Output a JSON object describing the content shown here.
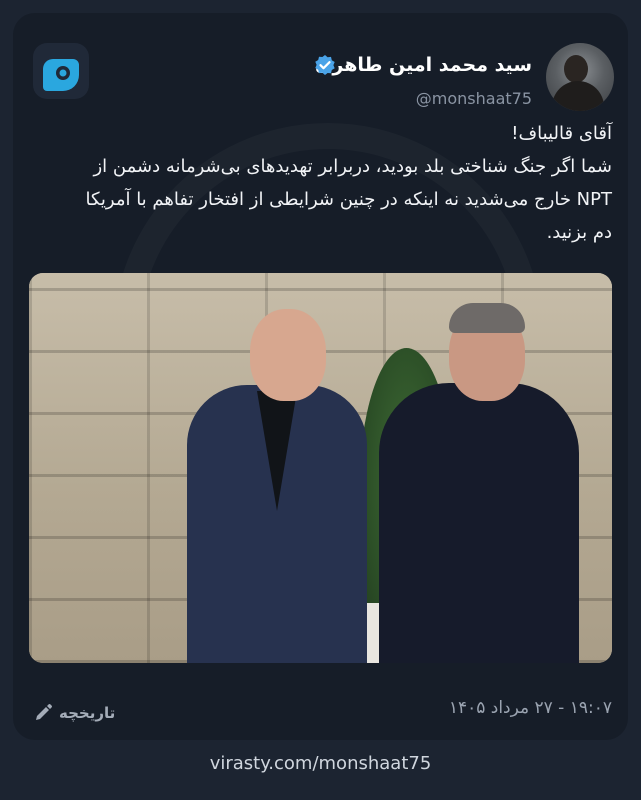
{
  "tweet": {
    "author_name": "سید محمد امین طاهری",
    "handle": "@monshaat75",
    "verified": true,
    "lines": [
      "آقای قالیباف!",
      "شما اگر جنگ شناختی بلد بودید، دربرابر تهدیدهای بی‌شرمانه دشمن از",
      "NPT خارج می‌شدید نه اینکه در چنین شرایطی از افتخار تفاهم با آمریکا",
      "دم بزنید."
    ],
    "timestamp": "۱۹:۰۷ - ۲۷ مرداد ۱۴۰۵",
    "history_label": "تاریخچه"
  },
  "footer": {
    "link": "virasty.com/monshaat75"
  },
  "colors": {
    "page_bg": "#1c2431",
    "card_bg": "#161d28",
    "accent": "#2aa7df",
    "verified_badge": "#4aa3e8"
  },
  "icons": {
    "app_logo": "virasty-logo-icon",
    "verified": "verified-badge-icon",
    "history": "pencil-icon"
  }
}
